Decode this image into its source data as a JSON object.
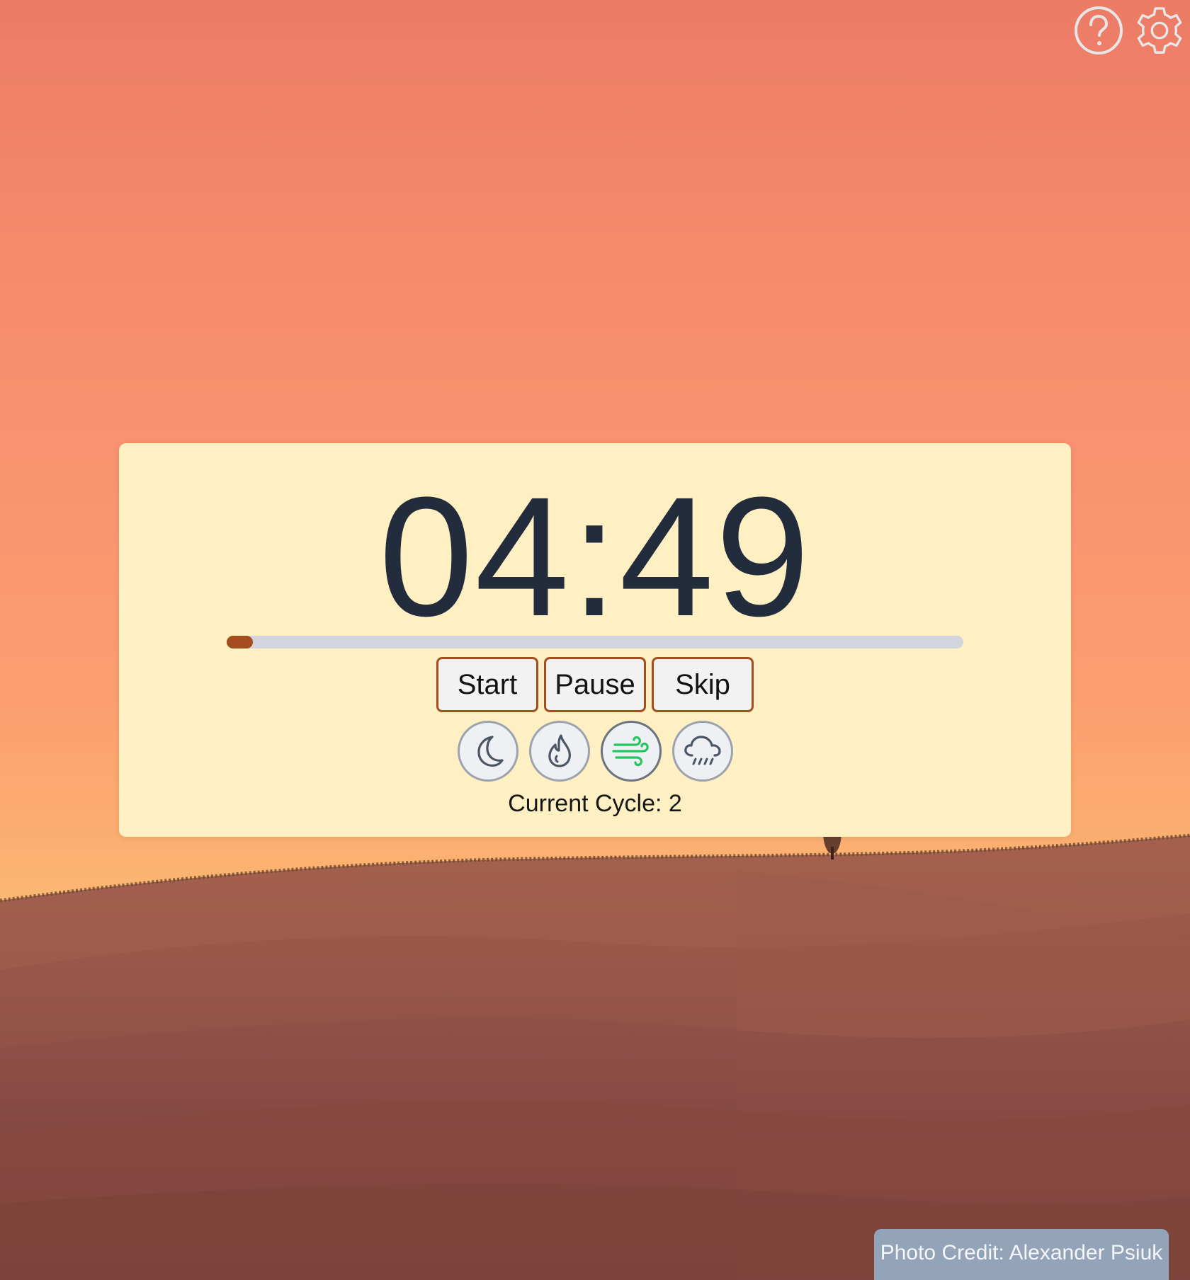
{
  "header": {
    "help_icon": "help-circle-icon",
    "settings_icon": "gear-icon"
  },
  "timer": {
    "display": "04:49",
    "progress_fraction": 0.036
  },
  "controls": {
    "start_label": "Start",
    "pause_label": "Pause",
    "skip_label": "Skip"
  },
  "sounds": [
    {
      "icon": "moon-icon",
      "active": false
    },
    {
      "icon": "flame-icon",
      "active": false
    },
    {
      "icon": "wind-icon",
      "active": true
    },
    {
      "icon": "rain-cloud-icon",
      "active": false
    }
  ],
  "cycle": {
    "text": "Current Cycle: 2"
  },
  "footer": {
    "photo_credit": "Photo Credit: Alexander Psiuk"
  },
  "colors": {
    "accent": "#a54d1e",
    "card_bg": "#fef0c2",
    "timer_text": "#232c3d",
    "wind_active": "#22c55e",
    "credit_bg": "#93a4b8"
  }
}
